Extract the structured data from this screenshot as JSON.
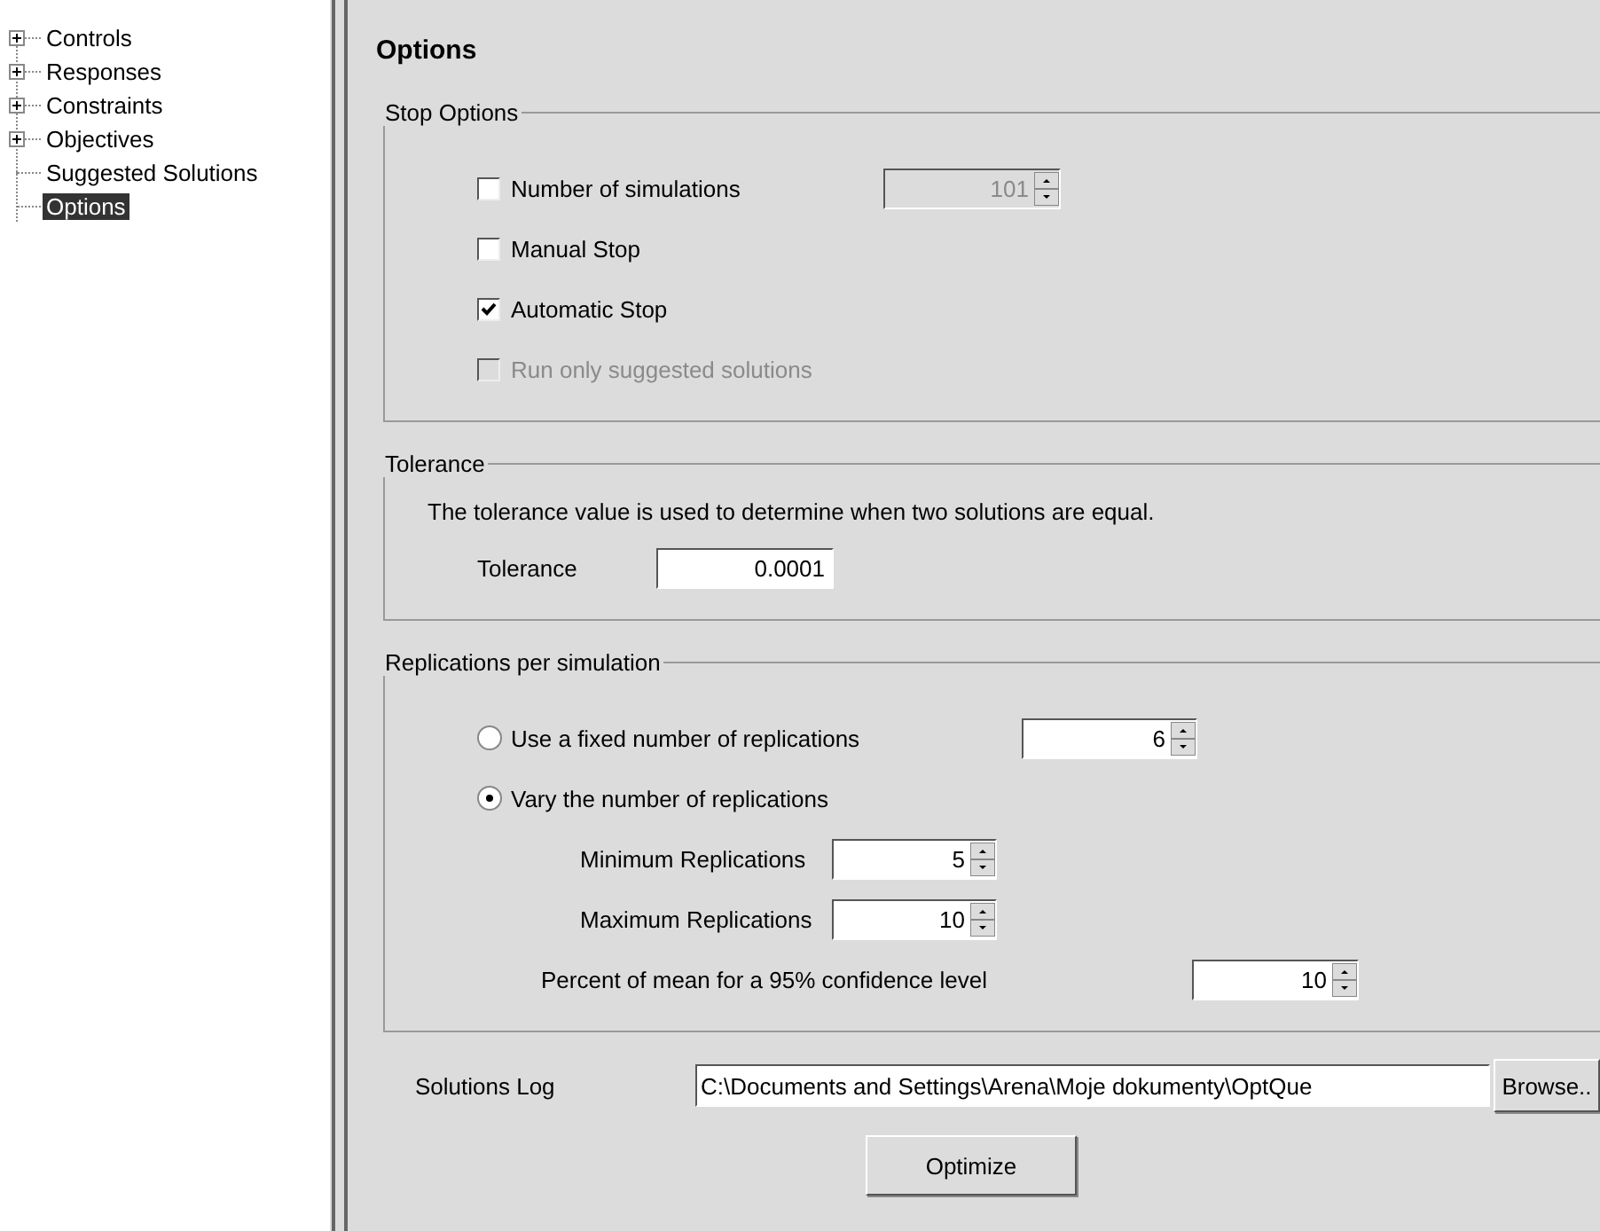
{
  "tree": [
    {
      "label": "Controls",
      "kind": "folder",
      "expanded": false,
      "selected": false
    },
    {
      "label": "Responses",
      "kind": "folder",
      "expanded": false,
      "selected": false
    },
    {
      "label": "Constraints",
      "kind": "folder",
      "expanded": false,
      "selected": false
    },
    {
      "label": "Objectives",
      "kind": "folder",
      "expanded": false,
      "selected": false
    },
    {
      "label": "Suggested Solutions",
      "kind": "leaf",
      "selected": false
    },
    {
      "label": "Options",
      "kind": "leaf",
      "selected": true
    }
  ],
  "title": "Options",
  "stop_options": {
    "legend": "Stop Options",
    "items": [
      {
        "label": "Number of simulations",
        "checked": false,
        "disabled": false,
        "spinner": {
          "value": "101",
          "disabled": true
        }
      },
      {
        "label": "Manual Stop",
        "checked": false,
        "disabled": false
      },
      {
        "label": "Automatic Stop",
        "checked": true,
        "disabled": false
      },
      {
        "label": "Run only suggested solutions",
        "checked": false,
        "disabled": true
      }
    ]
  },
  "tolerance": {
    "legend": "Tolerance",
    "description": "The tolerance value is used to determine when two solutions are equal.",
    "label": "Tolerance",
    "value": "0.0001"
  },
  "replications": {
    "legend": "Replications per simulation",
    "options": [
      {
        "label": "Use a fixed number of replications",
        "selected": false,
        "spinner": {
          "value": "6"
        }
      },
      {
        "label": "Vary the number of replications",
        "selected": true
      }
    ],
    "fields": [
      {
        "label": "Minimum Replications",
        "value": "5"
      },
      {
        "label": "Maximum Replications",
        "value": "10"
      },
      {
        "label": "Percent of mean for a 95% confidence level",
        "value": "10"
      }
    ]
  },
  "solutions_log": {
    "label": "Solutions Log",
    "value": "C:\\Documents and Settings\\Arena\\Moje dokumenty\\OptQue",
    "browse": "Browse.."
  },
  "optimize": "Optimize"
}
